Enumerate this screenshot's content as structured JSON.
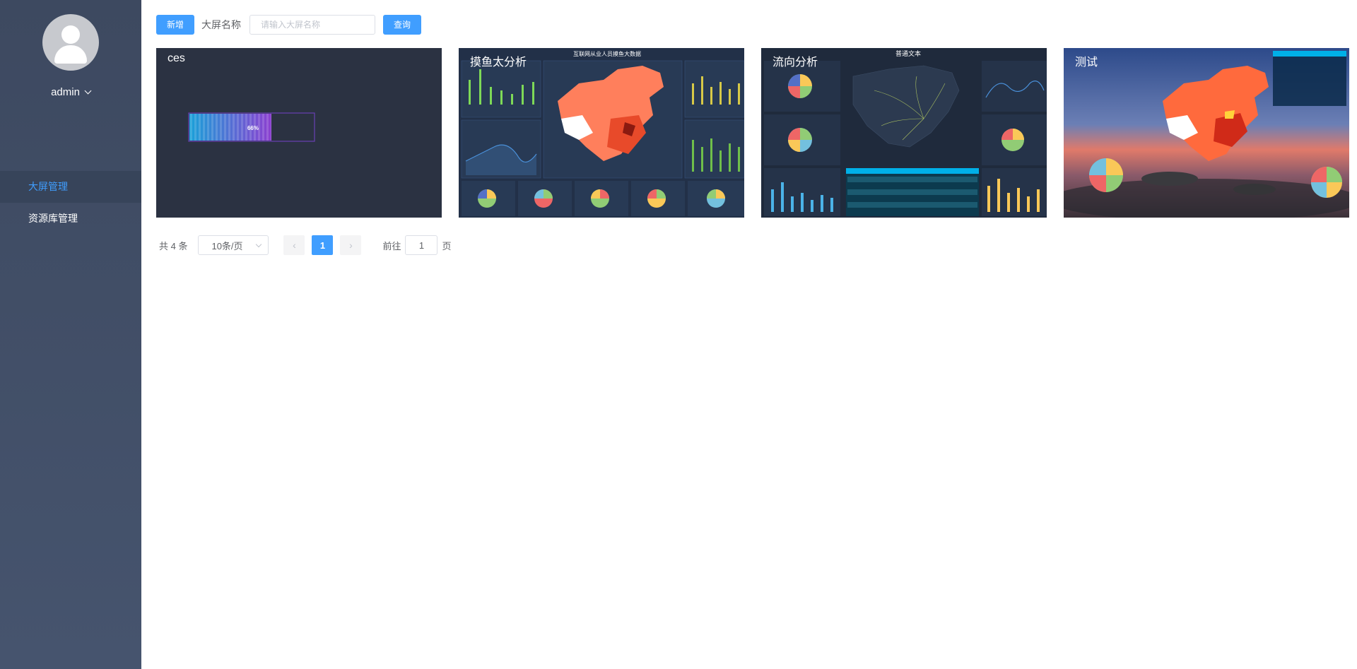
{
  "sidebar": {
    "username": "admin",
    "menu": [
      {
        "label": "大屏管理",
        "active": true
      },
      {
        "label": "资源库管理",
        "active": false
      }
    ]
  },
  "toolbar": {
    "add_label": "新增",
    "name_label": "大屏名称",
    "search_placeholder": "请输入大屏名称",
    "search_value": "",
    "query_label": "查询"
  },
  "cards": [
    {
      "title": "ces",
      "progress_label": "66%",
      "progress": 0.66
    },
    {
      "title": "摸鱼太分析",
      "header": "互联网从业人员摸鱼大数据"
    },
    {
      "title": "流向分析",
      "header": "普通文本"
    },
    {
      "title": "测试"
    }
  ],
  "pagination": {
    "total_label": "共 4 条",
    "page_size_label": "10条/页",
    "current_page": "1",
    "goto_prefix": "前往",
    "goto_value": "1",
    "goto_suffix": "页"
  },
  "colors": {
    "accent": "#409eff",
    "sidebar_bg": "#3d4960",
    "card_bg": "#2b3242"
  }
}
